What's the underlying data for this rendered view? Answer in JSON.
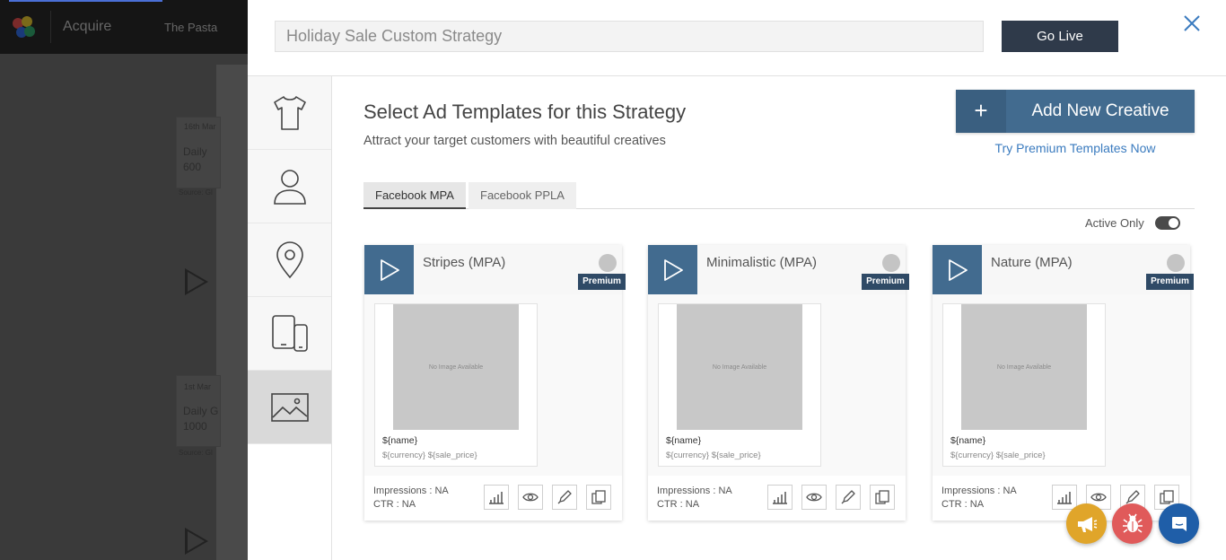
{
  "background": {
    "app_name": "Acquire",
    "store_name": "The Pasta",
    "dates": [
      "16th Mar",
      "1st Mar"
    ],
    "labels": [
      "Daily",
      "600",
      "Source: Gl",
      "Daily G",
      "1000",
      "Source: Gl"
    ]
  },
  "header": {
    "strategy_name": "Holiday Sale Custom Strategy",
    "go_live_label": "Go Live"
  },
  "sidebar": {
    "items": [
      {
        "name": "product",
        "icon": "tshirt-icon"
      },
      {
        "name": "audience",
        "icon": "person-icon"
      },
      {
        "name": "location",
        "icon": "location-pin-icon"
      },
      {
        "name": "devices",
        "icon": "devices-icon"
      },
      {
        "name": "creatives",
        "icon": "image-icon",
        "active": true
      }
    ]
  },
  "main": {
    "title": "Select Ad Templates for this Strategy",
    "subtitle": "Attract your target customers with beautiful creatives",
    "add_creative_plus": "+",
    "add_creative_label": "Add New Creative",
    "premium_link": "Try Premium Templates Now",
    "tabs": [
      {
        "label": "Facebook MPA",
        "active": true
      },
      {
        "label": "Facebook PPLA",
        "active": false
      }
    ],
    "active_only_label": "Active Only",
    "active_only_on": true
  },
  "cards": [
    {
      "title": "Stripes (MPA)",
      "badge": "Premium",
      "no_image": "No Image Available",
      "name_placeholder": "${name}",
      "price_placeholder": "${currency} ${sale_price}",
      "impressions": "Impressions : NA",
      "ctr": "CTR : NA"
    },
    {
      "title": "Minimalistic (MPA)",
      "badge": "Premium",
      "no_image": "No Image Available",
      "name_placeholder": "${name}",
      "price_placeholder": "${currency} ${sale_price}",
      "impressions": "Impressions : NA",
      "ctr": "CTR : NA"
    },
    {
      "title": "Nature (MPA)",
      "badge": "Premium",
      "no_image": "No Image Available",
      "name_placeholder": "${name}",
      "price_placeholder": "${currency} ${sale_price}",
      "impressions": "Impressions : NA",
      "ctr": "CTR : NA"
    }
  ],
  "colors": {
    "accent": "#426b8f",
    "header_button": "#2f3a4a",
    "premium_badge": "#2f4a66",
    "fab_announce": "#e0a52a",
    "fab_bug": "#e05a5a",
    "fab_chat": "#1f5ea8"
  }
}
